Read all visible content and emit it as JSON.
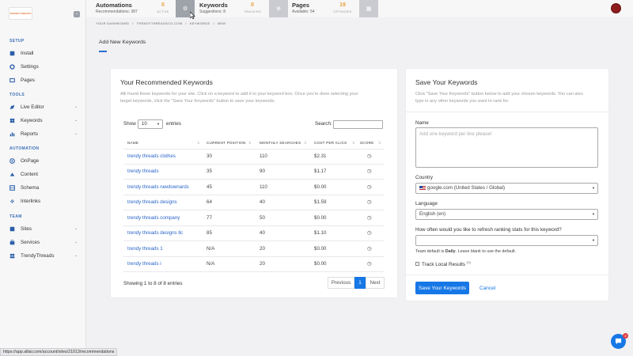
{
  "sidebar": {
    "logo_text": "TRENDYTHREADS",
    "collapse_icon": "chevron-left-icon",
    "sections": {
      "setup": "SETUP",
      "tools": "TOOLS",
      "automation": "AUTOMATION",
      "team": "TEAM"
    },
    "items": {
      "install": "Install",
      "settings": "Settings",
      "pages": "Pages",
      "live_editor": "Live Editor",
      "keywords": "Keywords",
      "reports": "Reports",
      "onpage": "OnPage",
      "content": "Content",
      "schema": "Schema",
      "interlinks": "Interlinks",
      "sites": "Sites",
      "services": "Services",
      "trendythreads": "TrendyThreads"
    }
  },
  "topbar": {
    "automations": {
      "title": "Automations",
      "sub": "Recommendations: 387",
      "count": "0",
      "count_label": "ACTIVE"
    },
    "keywords": {
      "title": "Keywords",
      "sub": "Suggestions: 8",
      "count": "0",
      "count_label": "TRACKING"
    },
    "pages": {
      "title": "Pages",
      "sub": "Available: 54",
      "count": "19",
      "count_label": "OPTIMIZED"
    },
    "accent": "#e8a23a"
  },
  "breadcrumb": [
    "YOUR DASHBOARD",
    "/",
    "TRENDYTHREADSCO.COM",
    "/",
    "KEYWORDS",
    "/",
    "NEW"
  ],
  "page_tab": "Add New Keywords",
  "recommended": {
    "title": "Your Recommended Keywords",
    "desc1": "Alli found these keywords for your site. Click on a keyword to add it to your keyword box. Once you're done selecting your",
    "desc2": "target keywords, click the \"Save Your Keywords\" button to save your keywords.",
    "show_label": "Show",
    "entries_value": "10",
    "entries_label": "entries",
    "search_label": "Search:",
    "columns": [
      "NAME",
      "CURRENT POSITION",
      "MONTHLY SEARCHES",
      "COST PER CLICK",
      "SCORE"
    ],
    "rows": [
      {
        "name": "trendy threads clothes",
        "position": "30",
        "searches": "110",
        "cpc": "$2.31"
      },
      {
        "name": "trendy threads",
        "position": "35",
        "searches": "90",
        "cpc": "$1.17"
      },
      {
        "name": "trendy threads newtownards",
        "position": "45",
        "searches": "110",
        "cpc": "$0.00"
      },
      {
        "name": "trendy threads designs",
        "position": "64",
        "searches": "40",
        "cpc": "$1.59"
      },
      {
        "name": "trendy threads company",
        "position": "77",
        "searches": "50",
        "cpc": "$0.00"
      },
      {
        "name": "trendy threads designs llc",
        "position": "85",
        "searches": "40",
        "cpc": "$1.10"
      },
      {
        "name": "trendy threads 1",
        "position": "N/A",
        "searches": "20",
        "cpc": "$0.00"
      },
      {
        "name": "trendy threads i",
        "position": "N/A",
        "searches": "20",
        "cpc": "$0.00"
      }
    ],
    "info": "Showing 1 to 8 of 8 entries",
    "pager": {
      "prev": "Previous",
      "current": "1",
      "next": "Next"
    }
  },
  "save": {
    "title": "Save Your Keywords",
    "desc1": "Click \"Save Your Keywords\" button below to add your chosen keywords. You can also",
    "desc2": "type in any other keywords you want to rank for.",
    "name_label": "Name",
    "name_placeholder": "Add one keyword per line please!",
    "country_label": "Country",
    "country_value": "google.com (United States / Global)",
    "language_label": "Language",
    "language_value": "English (en)",
    "refresh_label": "How often would you like to refresh ranking stats for this keyword?",
    "refresh_value": "",
    "note_pre": "Team default is ",
    "note_bold": "Daily",
    "note_post": ". Leave blank to use the default.",
    "track_label": "Track Local Results",
    "track_sup": "(?)",
    "save_button": "Save Your Keywords",
    "cancel_button": "Cancel"
  },
  "status_url": "https://app.alliai.com/account/sites/21013/recommendations",
  "chat_badge": "2",
  "colors": {
    "primary": "#1677e6",
    "link": "#2a65c9",
    "sidebar_accent": "#3b6fb6"
  }
}
